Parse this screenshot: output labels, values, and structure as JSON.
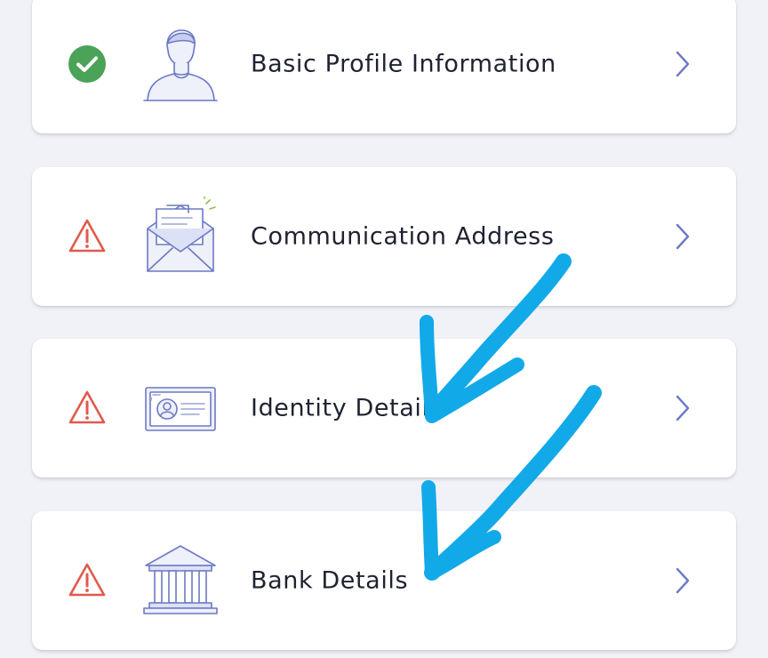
{
  "colors": {
    "success": "#4aa357",
    "warning": "#e05a4e",
    "icon_stroke": "#6c79c4",
    "chevron": "#6c79c4",
    "annotation": "#12a9e8"
  },
  "sections": [
    {
      "label": "Basic Profile Information",
      "status": "complete",
      "status_icon": "check-circle-icon",
      "illustration": "user-avatar-icon"
    },
    {
      "label": "Communication Address",
      "status": "incomplete",
      "status_icon": "warning-triangle-icon",
      "illustration": "open-envelope-icon"
    },
    {
      "label": "Identity Details",
      "status": "incomplete",
      "status_icon": "warning-triangle-icon",
      "illustration": "id-card-icon"
    },
    {
      "label": "Bank Details",
      "status": "incomplete",
      "status_icon": "warning-triangle-icon",
      "illustration": "bank-building-icon"
    }
  ]
}
